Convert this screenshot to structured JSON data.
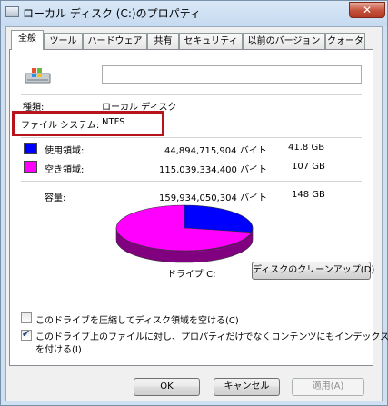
{
  "window": {
    "title": "ローカル ディスク (C:)のプロパティ",
    "close_glyph": "✕"
  },
  "tabs": [
    "全般",
    "ツール",
    "ハードウェア",
    "共有",
    "セキュリティ",
    "以前のバージョン",
    "クォータ"
  ],
  "general": {
    "type_label": "種類:",
    "type_value": "ローカル ディスク",
    "fs_label": "ファイル システム:",
    "fs_value": "NTFS",
    "used_label": "使用領域:",
    "used_bytes": "44,894,715,904 バイト",
    "used_size": "41.8 GB",
    "free_label": "空き領域:",
    "free_bytes": "115,039,334,400 バイト",
    "free_size": "107 GB",
    "capacity_label": "容量:",
    "capacity_bytes": "159,934,050,304 バイト",
    "capacity_size": "148 GB",
    "drive_label": "ドライブ C:",
    "cleanup_button": "ディスクのクリーンアップ(D)",
    "compress_checkbox": "このドライブを圧縮してディスク領域を空ける(C)",
    "compress_checked": false,
    "index_checkbox_line1": "このドライブ上のファイルに対し、プロパティだけでなくコンテンツにもインデックス",
    "index_checkbox_line2": "を付ける(I)",
    "index_checked": true
  },
  "colors": {
    "used": "#0000ff",
    "free": "#ff00ff",
    "highlight": "#b8121a"
  },
  "chart_data": {
    "type": "pie",
    "categories": [
      "使用領域",
      "空き領域"
    ],
    "values": [
      44894715904,
      115039334400
    ],
    "colors": [
      "#0000ff",
      "#ff00ff"
    ]
  },
  "buttons": {
    "ok": "OK",
    "cancel": "キャンセル",
    "apply": "適用(A)"
  }
}
